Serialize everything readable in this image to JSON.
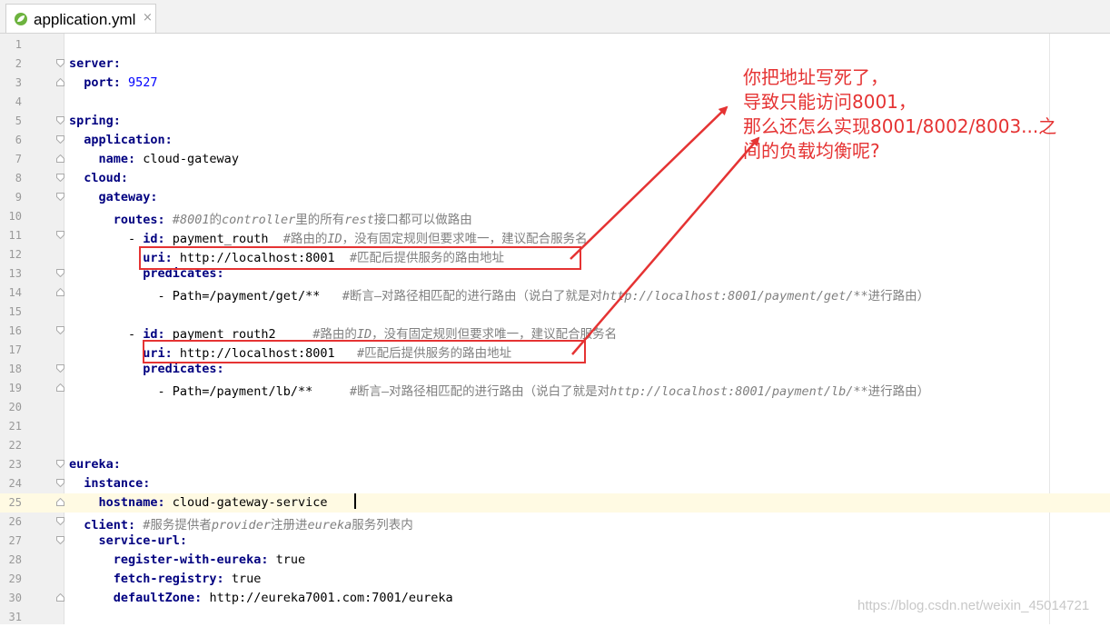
{
  "tab": {
    "label": "application.yml",
    "close": "×"
  },
  "editor": {
    "line_numbers": [
      "1",
      "2",
      "3",
      "4",
      "5",
      "6",
      "7",
      "8",
      "9",
      "10",
      "11",
      "12",
      "13",
      "14",
      "15",
      "16",
      "17",
      "18",
      "19",
      "20",
      "21",
      "22",
      "23",
      "24",
      "25",
      "26",
      "27",
      "28",
      "29",
      "30",
      "31"
    ],
    "current_line": 25,
    "lines": [
      {
        "n": 1,
        "segments": []
      },
      {
        "n": 2,
        "segments": [
          {
            "t": "server:",
            "c": "key"
          }
        ]
      },
      {
        "n": 3,
        "segments": [
          {
            "t": "  port: ",
            "c": "key"
          },
          {
            "t": "9527",
            "c": "num"
          }
        ]
      },
      {
        "n": 4,
        "segments": []
      },
      {
        "n": 5,
        "segments": [
          {
            "t": "spring:",
            "c": "key"
          }
        ]
      },
      {
        "n": 6,
        "segments": [
          {
            "t": "  application:",
            "c": "key"
          }
        ]
      },
      {
        "n": 7,
        "segments": [
          {
            "t": "    name: ",
            "c": "key"
          },
          {
            "t": "cloud-gateway",
            "c": ""
          }
        ]
      },
      {
        "n": 8,
        "segments": [
          {
            "t": "  cloud:",
            "c": "key"
          }
        ]
      },
      {
        "n": 9,
        "segments": [
          {
            "t": "    gateway:",
            "c": "key"
          }
        ]
      },
      {
        "n": 10,
        "segments": [
          {
            "t": "      routes: ",
            "c": "key"
          },
          {
            "t": "#",
            "c": "cmt"
          },
          {
            "t": "8001",
            "c": "cmti"
          },
          {
            "t": "的",
            "c": "cmt"
          },
          {
            "t": "controller",
            "c": "cmti"
          },
          {
            "t": "里的所有",
            "c": "cmt"
          },
          {
            "t": "rest",
            "c": "cmti"
          },
          {
            "t": "接口都可以做路由",
            "c": "cmt"
          }
        ]
      },
      {
        "n": 11,
        "segments": [
          {
            "t": "        - ",
            "c": ""
          },
          {
            "t": "id: ",
            "c": "key"
          },
          {
            "t": "payment_routh  ",
            "c": ""
          },
          {
            "t": "#路由的",
            "c": "cmt"
          },
          {
            "t": "ID",
            "c": "cmti"
          },
          {
            "t": "，没有固定规则但要求唯一，建议配合服务名",
            "c": "cmt"
          }
        ]
      },
      {
        "n": 12,
        "segments": [
          {
            "t": "          uri: ",
            "c": "key"
          },
          {
            "t": "http://localhost:8001  ",
            "c": ""
          },
          {
            "t": "#匹配后提供服务的路由地址",
            "c": "cmt"
          }
        ]
      },
      {
        "n": 13,
        "segments": [
          {
            "t": "          predicates:",
            "c": "key"
          }
        ]
      },
      {
        "n": 14,
        "segments": [
          {
            "t": "            - Path=/payment/get/**   ",
            "c": ""
          },
          {
            "t": "#断言—对路径相匹配的进行路由（说白了就是对",
            "c": "cmt"
          },
          {
            "t": "http://localhost:8001/payment/get/**",
            "c": "cmti"
          },
          {
            "t": "进行路由）",
            "c": "cmt"
          }
        ]
      },
      {
        "n": 15,
        "segments": []
      },
      {
        "n": 16,
        "segments": [
          {
            "t": "        - ",
            "c": ""
          },
          {
            "t": "id: ",
            "c": "key"
          },
          {
            "t": "payment_routh2     ",
            "c": ""
          },
          {
            "t": "#路由的",
            "c": "cmt"
          },
          {
            "t": "ID",
            "c": "cmti"
          },
          {
            "t": "，没有固定规则但要求唯一，建议配合服务名",
            "c": "cmt"
          }
        ]
      },
      {
        "n": 17,
        "segments": [
          {
            "t": "          uri: ",
            "c": "key"
          },
          {
            "t": "http://localhost:8001   ",
            "c": ""
          },
          {
            "t": "#匹配后提供服务的路由地址",
            "c": "cmt"
          }
        ]
      },
      {
        "n": 18,
        "segments": [
          {
            "t": "          predicates:",
            "c": "key"
          }
        ]
      },
      {
        "n": 19,
        "segments": [
          {
            "t": "            - Path=/payment/lb/**     ",
            "c": ""
          },
          {
            "t": "#断言—对路径相匹配的进行路由（说白了就是对",
            "c": "cmt"
          },
          {
            "t": "http://localhost:8001/payment/lb/**",
            "c": "cmti"
          },
          {
            "t": "进行路由）",
            "c": "cmt"
          }
        ]
      },
      {
        "n": 20,
        "segments": []
      },
      {
        "n": 21,
        "segments": []
      },
      {
        "n": 22,
        "segments": []
      },
      {
        "n": 23,
        "segments": [
          {
            "t": "eureka:",
            "c": "key"
          }
        ]
      },
      {
        "n": 24,
        "segments": [
          {
            "t": "  instance:",
            "c": "key"
          }
        ]
      },
      {
        "n": 25,
        "segments": [
          {
            "t": "    hostname: ",
            "c": "key"
          },
          {
            "t": "cloud-gateway-service",
            "c": ""
          }
        ]
      },
      {
        "n": 26,
        "segments": [
          {
            "t": "  client: ",
            "c": "key"
          },
          {
            "t": "#服务提供者",
            "c": "cmt"
          },
          {
            "t": "provider",
            "c": "cmti"
          },
          {
            "t": "注册进",
            "c": "cmt"
          },
          {
            "t": "eureka",
            "c": "cmti"
          },
          {
            "t": "服务列表内",
            "c": "cmt"
          }
        ]
      },
      {
        "n": 27,
        "segments": [
          {
            "t": "    service-url:",
            "c": "key"
          }
        ]
      },
      {
        "n": 28,
        "segments": [
          {
            "t": "      register-with-eureka: ",
            "c": "key"
          },
          {
            "t": "true",
            "c": ""
          }
        ]
      },
      {
        "n": 29,
        "segments": [
          {
            "t": "      fetch-registry: ",
            "c": "key"
          },
          {
            "t": "true",
            "c": ""
          }
        ]
      },
      {
        "n": 30,
        "segments": [
          {
            "t": "      defaultZone: ",
            "c": "key"
          },
          {
            "t": "http://eureka7001.com:7001/eureka",
            "c": ""
          }
        ]
      },
      {
        "n": 31,
        "segments": []
      }
    ]
  },
  "annotation": {
    "text": "你把地址写死了，\n导致只能访问8001，\n那么还怎么实现8001/8002/8003...之\n间的负载均衡呢?",
    "color": "#e53333"
  },
  "watermark": "https://blog.csdn.net/weixin_45014721",
  "colors": {
    "key": "#000080",
    "number": "#0000ff",
    "comment": "#808080",
    "current_line": "#fffae3"
  }
}
